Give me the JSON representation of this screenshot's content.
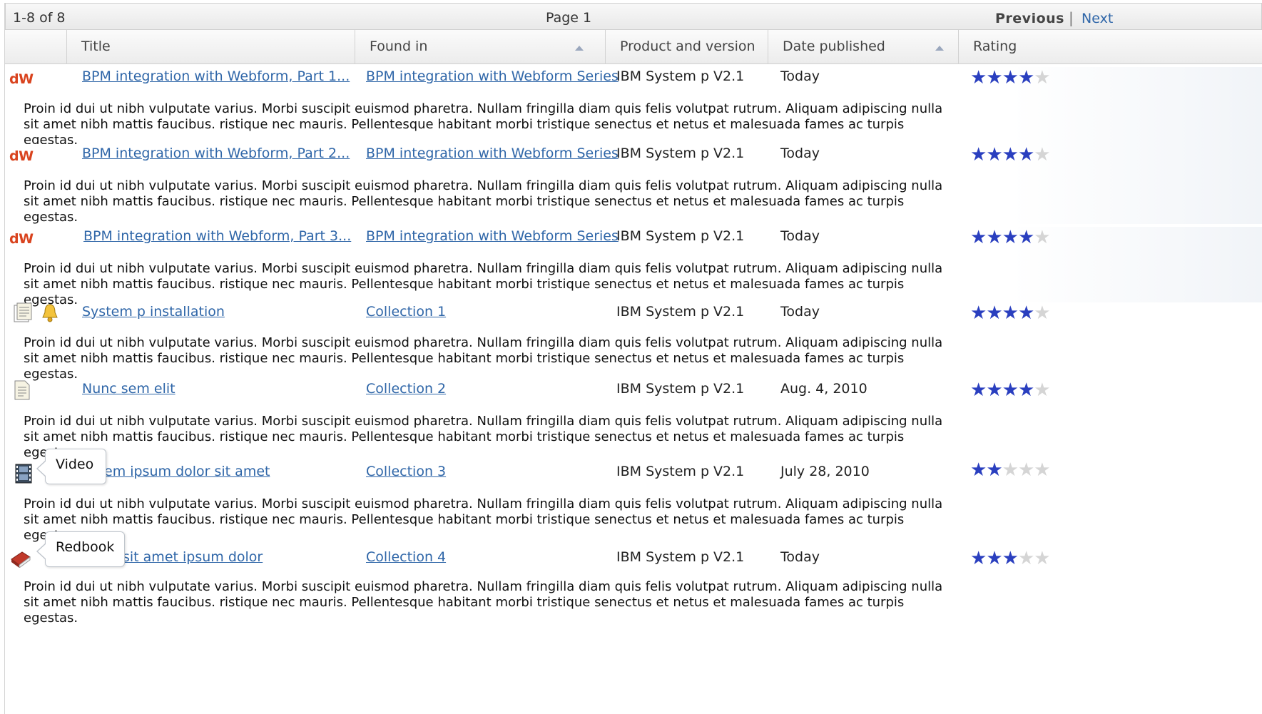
{
  "pager": {
    "count": "1-8  of 8",
    "page": "Page 1",
    "previous": "Previous",
    "separator": "|",
    "next": "Next"
  },
  "columns": {
    "title": "Title",
    "found_in": "Found in",
    "product": "Product and version",
    "date": "Date published",
    "rating": "Rating"
  },
  "description": "Proin id dui ut nibh vulputate varius. Morbi suscipit euismod pharetra. Nullam fringilla diam quis felis volutpat rutrum. Aliquam adipiscing nulla sit amet nibh mattis faucibus. ristique nec mauris. Pellentesque habitant morbi tristique senectus et netus et malesuada fames ac turpis egestas.",
  "rows": [
    {
      "icon": "dw-logo",
      "icon_text": "dW",
      "title": "BPM integration with Webform, Part 1...",
      "found_in": "BPM integration with Webform Series",
      "product": "IBM System p V2.1",
      "date": "Today",
      "rating": 4
    },
    {
      "icon": "dw-logo",
      "icon_text": "dW",
      "title": "BPM integration with Webform, Part 2...",
      "found_in": "BPM integration with Webform Series",
      "product": "IBM System p V2.1",
      "date": "Today",
      "rating": 4
    },
    {
      "icon": "dw-logo",
      "icon_text": "dW",
      "title": "BPM integration with Webform, Part 3...",
      "found_in": "BPM integration with Webform Series",
      "product": "IBM System p V2.1",
      "date": "Today",
      "rating": 4
    },
    {
      "icon": "document-bell",
      "title": "System p installation",
      "found_in": "Collection 1",
      "product": "IBM System p V2.1",
      "date": "Today",
      "rating": 4
    },
    {
      "icon": "document",
      "title": "Nunc sem elit",
      "found_in": "Collection 2",
      "product": "IBM System p V2.1",
      "date": "Aug. 4, 2010",
      "rating": 4
    },
    {
      "icon": "film",
      "title": "em ipsum dolor sit amet",
      "found_in": "Collection 3",
      "product": "IBM System p V2.1",
      "date": "July 28, 2010",
      "rating": 2
    },
    {
      "icon": "book",
      "title": "sit amet ipsum dolor",
      "found_in": "Collection 4",
      "product": "IBM System p V2.1",
      "date": "Today",
      "rating": 3
    }
  ],
  "tooltips": {
    "video": "Video",
    "redbook": "Redbook"
  },
  "colors": {
    "link": "#2f66a8",
    "star_on": "#2a3fbf",
    "star_off": "#d5d5d5",
    "dw": "#d9431e"
  }
}
